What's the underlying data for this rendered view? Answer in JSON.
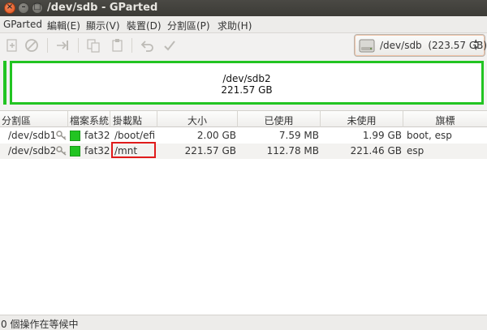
{
  "window": {
    "title": "/dev/sdb - GParted"
  },
  "menubar": {
    "items": [
      {
        "label": "GParted"
      },
      {
        "label": "編輯(E)"
      },
      {
        "label": "顯示(V)"
      },
      {
        "label": "裝置(D)"
      },
      {
        "label": "分割區(P)"
      },
      {
        "label": "求助(H)"
      }
    ]
  },
  "toolbar": {
    "icons": [
      "new-partition-icon",
      "delete-icon",
      "resize-move-icon",
      "copy-icon",
      "paste-icon",
      "undo-icon",
      "apply-icon"
    ]
  },
  "device_selector": {
    "device": "/dev/sdb",
    "size": "(223.57 GB)"
  },
  "disk_graphic": {
    "partition_name": "/dev/sdb2",
    "partition_size": "221.57 GB",
    "fs_color": "#22c422"
  },
  "table": {
    "headers": {
      "partition": "分割區",
      "filesystem": "檔案系統",
      "mountpoint": "掛載點",
      "size": "大小",
      "used": "已使用",
      "unused": "未使用",
      "flags": "旗標"
    },
    "rows": [
      {
        "partition": "/dev/sdb1",
        "filesystem": "fat32",
        "mountpoint": "/boot/efi",
        "size": "2.00 GB",
        "used": "7.59 MB",
        "unused": "1.99 GB",
        "flags": "boot, esp"
      },
      {
        "partition": "/dev/sdb2",
        "filesystem": "fat32",
        "mountpoint": "/mnt",
        "size": "221.57 GB",
        "used": "112.78 MB",
        "unused": "221.46 GB",
        "flags": "esp"
      }
    ]
  },
  "statusbar": {
    "text": "0 個操作在等候中"
  }
}
